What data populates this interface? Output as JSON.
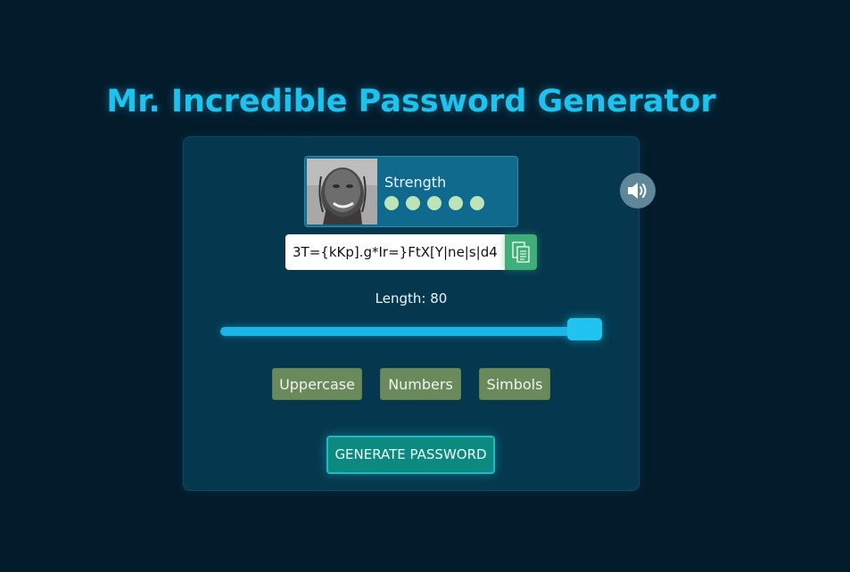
{
  "page_title": "Mr. Incredible Password Generator",
  "strength": {
    "label": "Strength",
    "dots_filled": 5,
    "dots_total": 5,
    "dot_color": "#bde4b8"
  },
  "password": {
    "value": "3T={kKp].g*Ir=}FtX[Y|ne|s|d4",
    "copy_icon": "copy-icon"
  },
  "sound": {
    "icon": "speaker-icon"
  },
  "length": {
    "label": "Length: 80",
    "value": 80,
    "slider_fraction": 0.95
  },
  "options": {
    "uppercase": "Uppercase",
    "numbers": "Numbers",
    "symbols": "Simbols"
  },
  "generate_button": "GENERATE PASSWORD",
  "colors": {
    "background": "#041b2b",
    "accent": "#1ec2ee",
    "card": "#05384f",
    "option_button": "#6b8a5c",
    "generate_button": "#0d8a80",
    "copy_button": "#3fae78"
  }
}
